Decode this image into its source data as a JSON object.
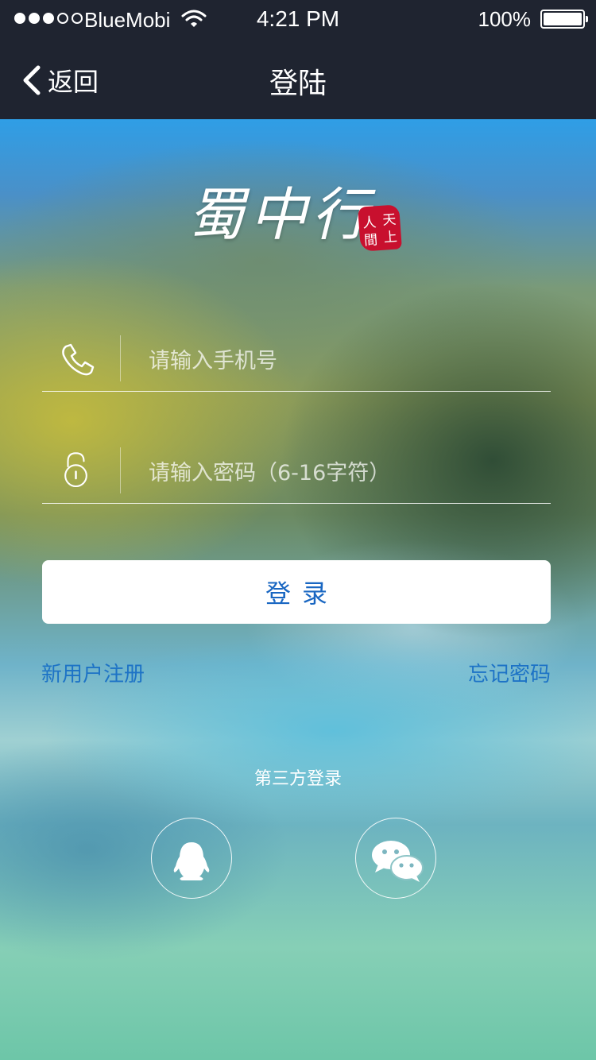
{
  "status_bar": {
    "carrier": "BlueMobi",
    "time": "4:21 PM",
    "battery_percent": "100%",
    "battery_level": 1.0,
    "signal_bars_filled": 3,
    "signal_bars_total": 5
  },
  "nav": {
    "back_label": "返回",
    "title": "登陆"
  },
  "logo": {
    "text": "蜀中行",
    "seal_text": "天上人間"
  },
  "form": {
    "phone_placeholder": "请输入手机号",
    "phone_value": "",
    "password_placeholder": "请输入密码（6-16字符）",
    "password_value": "",
    "login_label": "登录"
  },
  "links": {
    "register": "新用户注册",
    "forgot_password": "忘记密码"
  },
  "third_party": {
    "title": "第三方登录",
    "providers": [
      "qq-icon",
      "wechat-icon"
    ]
  },
  "colors": {
    "bar_background": "#1f2430",
    "link_blue": "#1d73c6",
    "button_text_blue": "#1a67c2",
    "seal_red": "#c8102e"
  }
}
